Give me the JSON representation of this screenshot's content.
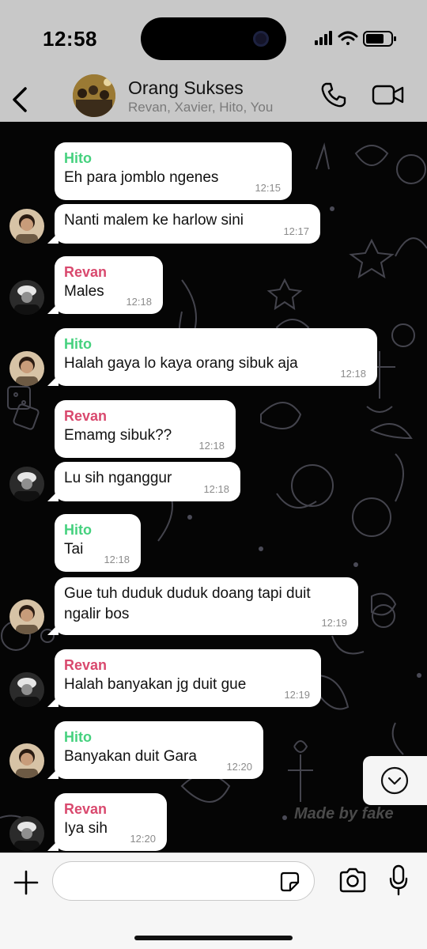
{
  "status_bar": {
    "time": "12:58"
  },
  "header": {
    "title": "Orang Sukses",
    "members": "Revan, Xavier, Hito, You"
  },
  "messages": [
    {
      "sender": "Hito",
      "text": "Eh para jomblo ngenes",
      "time": "12:15"
    },
    {
      "sender": "",
      "text": "Nanti malem ke harlow sini",
      "time": "12:17"
    },
    {
      "sender": "Revan",
      "text": "Males",
      "time": "12:18"
    },
    {
      "sender": "Hito",
      "text": "Halah gaya lo kaya orang sibuk aja",
      "time": "12:18"
    },
    {
      "sender": "Revan",
      "text": "Emamg sibuk??",
      "time": "12:18"
    },
    {
      "sender": "",
      "text": "Lu sih nganggur",
      "time": "12:18"
    },
    {
      "sender": "Hito",
      "text": "Tai",
      "time": "12:18"
    },
    {
      "sender": "",
      "text": "Gue tuh duduk duduk doang tapi duit ngalir bos",
      "time": "12:19"
    },
    {
      "sender": "Revan",
      "text": "Halah banyakan jg duit gue",
      "time": "12:19"
    },
    {
      "sender": "Hito",
      "text": "Banyakan duit Gara",
      "time": "12:20"
    },
    {
      "sender": "Revan",
      "text": "Iya sih",
      "time": "12:20"
    }
  ],
  "watermark": "Made by fake",
  "input": {
    "placeholder": ""
  },
  "colors": {
    "hito_name": "#45d17e",
    "revan_name": "#d9496e",
    "header_bg": "#c8c8c8",
    "chat_bg": "#050505",
    "bubble_bg": "#ffffff"
  },
  "icons": [
    "back-chevron-icon",
    "phone-icon",
    "video-camera-icon",
    "plus-icon",
    "sticker-icon",
    "camera-icon",
    "microphone-icon",
    "chevron-down-circle-icon"
  ]
}
